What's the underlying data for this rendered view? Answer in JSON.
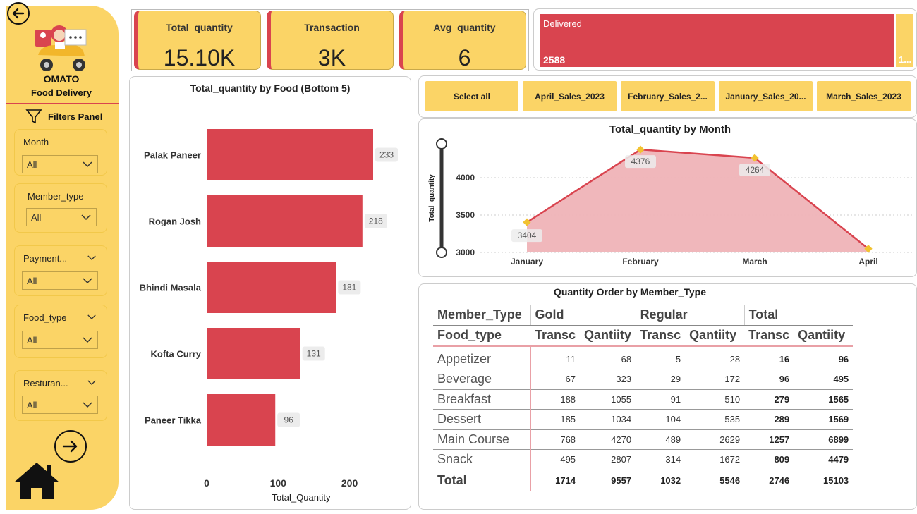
{
  "brand": {
    "title": "OMATO",
    "subtitle": "Food Delivery"
  },
  "sidebar": {
    "filters_label": "Filters Panel",
    "slicers": [
      {
        "label": "Month",
        "value": "All"
      },
      {
        "label": "Member_type",
        "value": "All"
      },
      {
        "label": "Payment...",
        "value": "All"
      },
      {
        "label": "Food_type",
        "value": "All"
      },
      {
        "label": "Resturan...",
        "value": "All"
      }
    ]
  },
  "kpis": [
    {
      "title": "Total_quantity",
      "value": "15.10K"
    },
    {
      "title": "Transaction",
      "value": "3K"
    },
    {
      "title": "Avg_quantity",
      "value": "6"
    }
  ],
  "status": {
    "label": "Delivered",
    "value": "2588",
    "rest_value": "1...",
    "delivered_share": 0.947
  },
  "month_tabs": [
    "Select all",
    "April_Sales_2023",
    "February_Sales_2...",
    "January_Sales_20...",
    "March_Sales_2023"
  ],
  "chart_data": [
    {
      "type": "bar",
      "orientation": "horizontal",
      "title": "Total_quantity by Food (Bottom 5)",
      "xlabel": "Total_Quantity",
      "ylabel": "",
      "categories": [
        "Palak Paneer",
        "Rogan Josh",
        "Bhindi Masala",
        "Kofta Curry",
        "Paneer Tikka"
      ],
      "values": [
        233,
        218,
        181,
        131,
        96
      ],
      "xticks": [
        0,
        100,
        200
      ],
      "xlim": [
        0,
        233
      ],
      "color": "#D9444F"
    },
    {
      "type": "area",
      "title": "Total_quantity by Month",
      "xlabel": "",
      "ylabel": "Total_quantity",
      "categories": [
        "January",
        "February",
        "March",
        "April"
      ],
      "values": [
        3404,
        4376,
        4264,
        3049
      ],
      "data_labels": [
        "3404",
        "4376",
        "4264",
        ""
      ],
      "yticks": [
        3000,
        3500,
        4000
      ],
      "ylim": [
        3000,
        4500
      ],
      "line_color": "#D9444F",
      "fill_color": "#EFB3B7",
      "marker_color": "#F2C230"
    }
  ],
  "matrix": {
    "title": "Quantity Order by Member_Type",
    "col_group_header": "Member_Type",
    "row_header": "Food_type",
    "groups": [
      "Gold",
      "Regular",
      "Total"
    ],
    "sub_headers": [
      "Transc",
      "Qantiity"
    ],
    "rows": [
      {
        "label": "Appetizer",
        "values": [
          "11",
          "68",
          "5",
          "28",
          "16",
          "96"
        ]
      },
      {
        "label": "Beverage",
        "values": [
          "67",
          "323",
          "29",
          "172",
          "96",
          "495"
        ]
      },
      {
        "label": "Breakfast",
        "values": [
          "188",
          "1055",
          "91",
          "510",
          "279",
          "1565"
        ]
      },
      {
        "label": "Dessert",
        "values": [
          "185",
          "1034",
          "104",
          "535",
          "289",
          "1569"
        ]
      },
      {
        "label": "Main Course",
        "values": [
          "768",
          "4270",
          "489",
          "2629",
          "1257",
          "6899"
        ]
      },
      {
        "label": "Snack",
        "values": [
          "495",
          "2807",
          "314",
          "1672",
          "809",
          "4479"
        ]
      }
    ],
    "total": {
      "label": "Total",
      "values": [
        "1714",
        "9557",
        "1032",
        "5546",
        "2746",
        "15103"
      ]
    }
  }
}
